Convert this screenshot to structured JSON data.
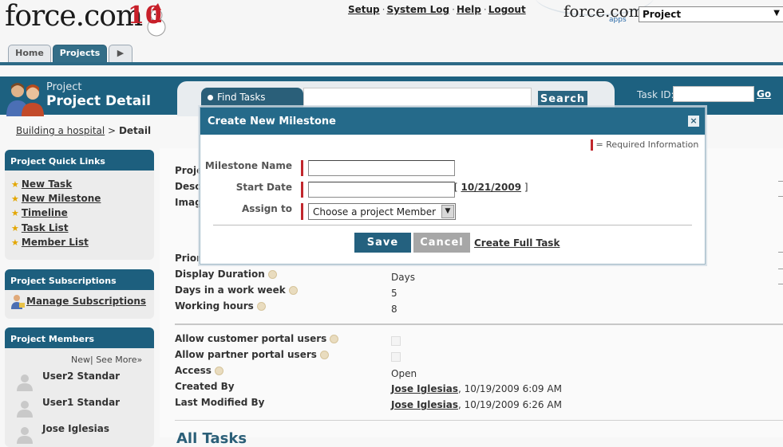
{
  "header": {
    "logo_text": "force.com",
    "logo_badge": "10",
    "links": [
      "Setup",
      "System Log",
      "Help",
      "Logout"
    ],
    "apps_logo": "force.com",
    "apps_sub": "apps",
    "app_selector_value": "Project"
  },
  "tabs": [
    {
      "label": "Home",
      "active": false
    },
    {
      "label": "Projects",
      "active": true
    }
  ],
  "page_header": {
    "label": "Project",
    "title": "Project Detail",
    "find_tab_label": "Find Tasks",
    "search_button": "Search",
    "task_id_label": "Task ID:",
    "go_label": "Go"
  },
  "breadcrumb": {
    "link": "Building a hospital",
    "separator": ">",
    "current": "Detail"
  },
  "sidebar": {
    "quick_links": {
      "title": "Project Quick Links",
      "items": [
        "New Task",
        "New Milestone",
        "Timeline",
        "Task List",
        "Member List"
      ]
    },
    "subscriptions": {
      "title": "Project Subscriptions",
      "manage_label": "Manage Subscriptions"
    },
    "members": {
      "title": "Project Members",
      "new_label": "New",
      "more_label": "See More»",
      "list": [
        "User2 Standar",
        "User1 Standar",
        "Jose Iglesias"
      ]
    }
  },
  "detail": {
    "partial_labels": [
      "Proje",
      "Desc",
      "Imag",
      "Prior"
    ],
    "fields": [
      {
        "label": "Display Duration",
        "value": "Days"
      },
      {
        "label": "Days in a work week",
        "value": "5"
      },
      {
        "label": "Working hours",
        "value": "8"
      }
    ],
    "flags": [
      {
        "label": "Allow customer portal users"
      },
      {
        "label": "Allow partner portal users"
      }
    ],
    "access": {
      "label": "Access",
      "value": "Open"
    },
    "created_by": {
      "label": "Created By",
      "user": "Jose Iglesias",
      "date": ", 10/19/2009 6:09 AM"
    },
    "modified_by": {
      "label": "Last Modified By",
      "user": "Jose Iglesias",
      "date": ", 10/19/2009 6:26 AM"
    },
    "section_partial": "All Tasks"
  },
  "dialog": {
    "title": "Create New Milestone",
    "close_glyph": "×",
    "required_note": "= Required Information",
    "fields": {
      "milestone_name_label": "Milestone Name",
      "milestone_name_value": "",
      "start_date_label": "Start Date",
      "start_date_value": "",
      "start_date_default": "10/21/2009",
      "assign_to_label": "Assign to",
      "assign_to_value": "Choose a project Member"
    },
    "save_label": "Save",
    "cancel_label": "Cancel",
    "full_task_label": "Create Full Task"
  },
  "colors": {
    "brand": "#1d6180",
    "required": "#c1272d",
    "star": "#e3a600"
  }
}
